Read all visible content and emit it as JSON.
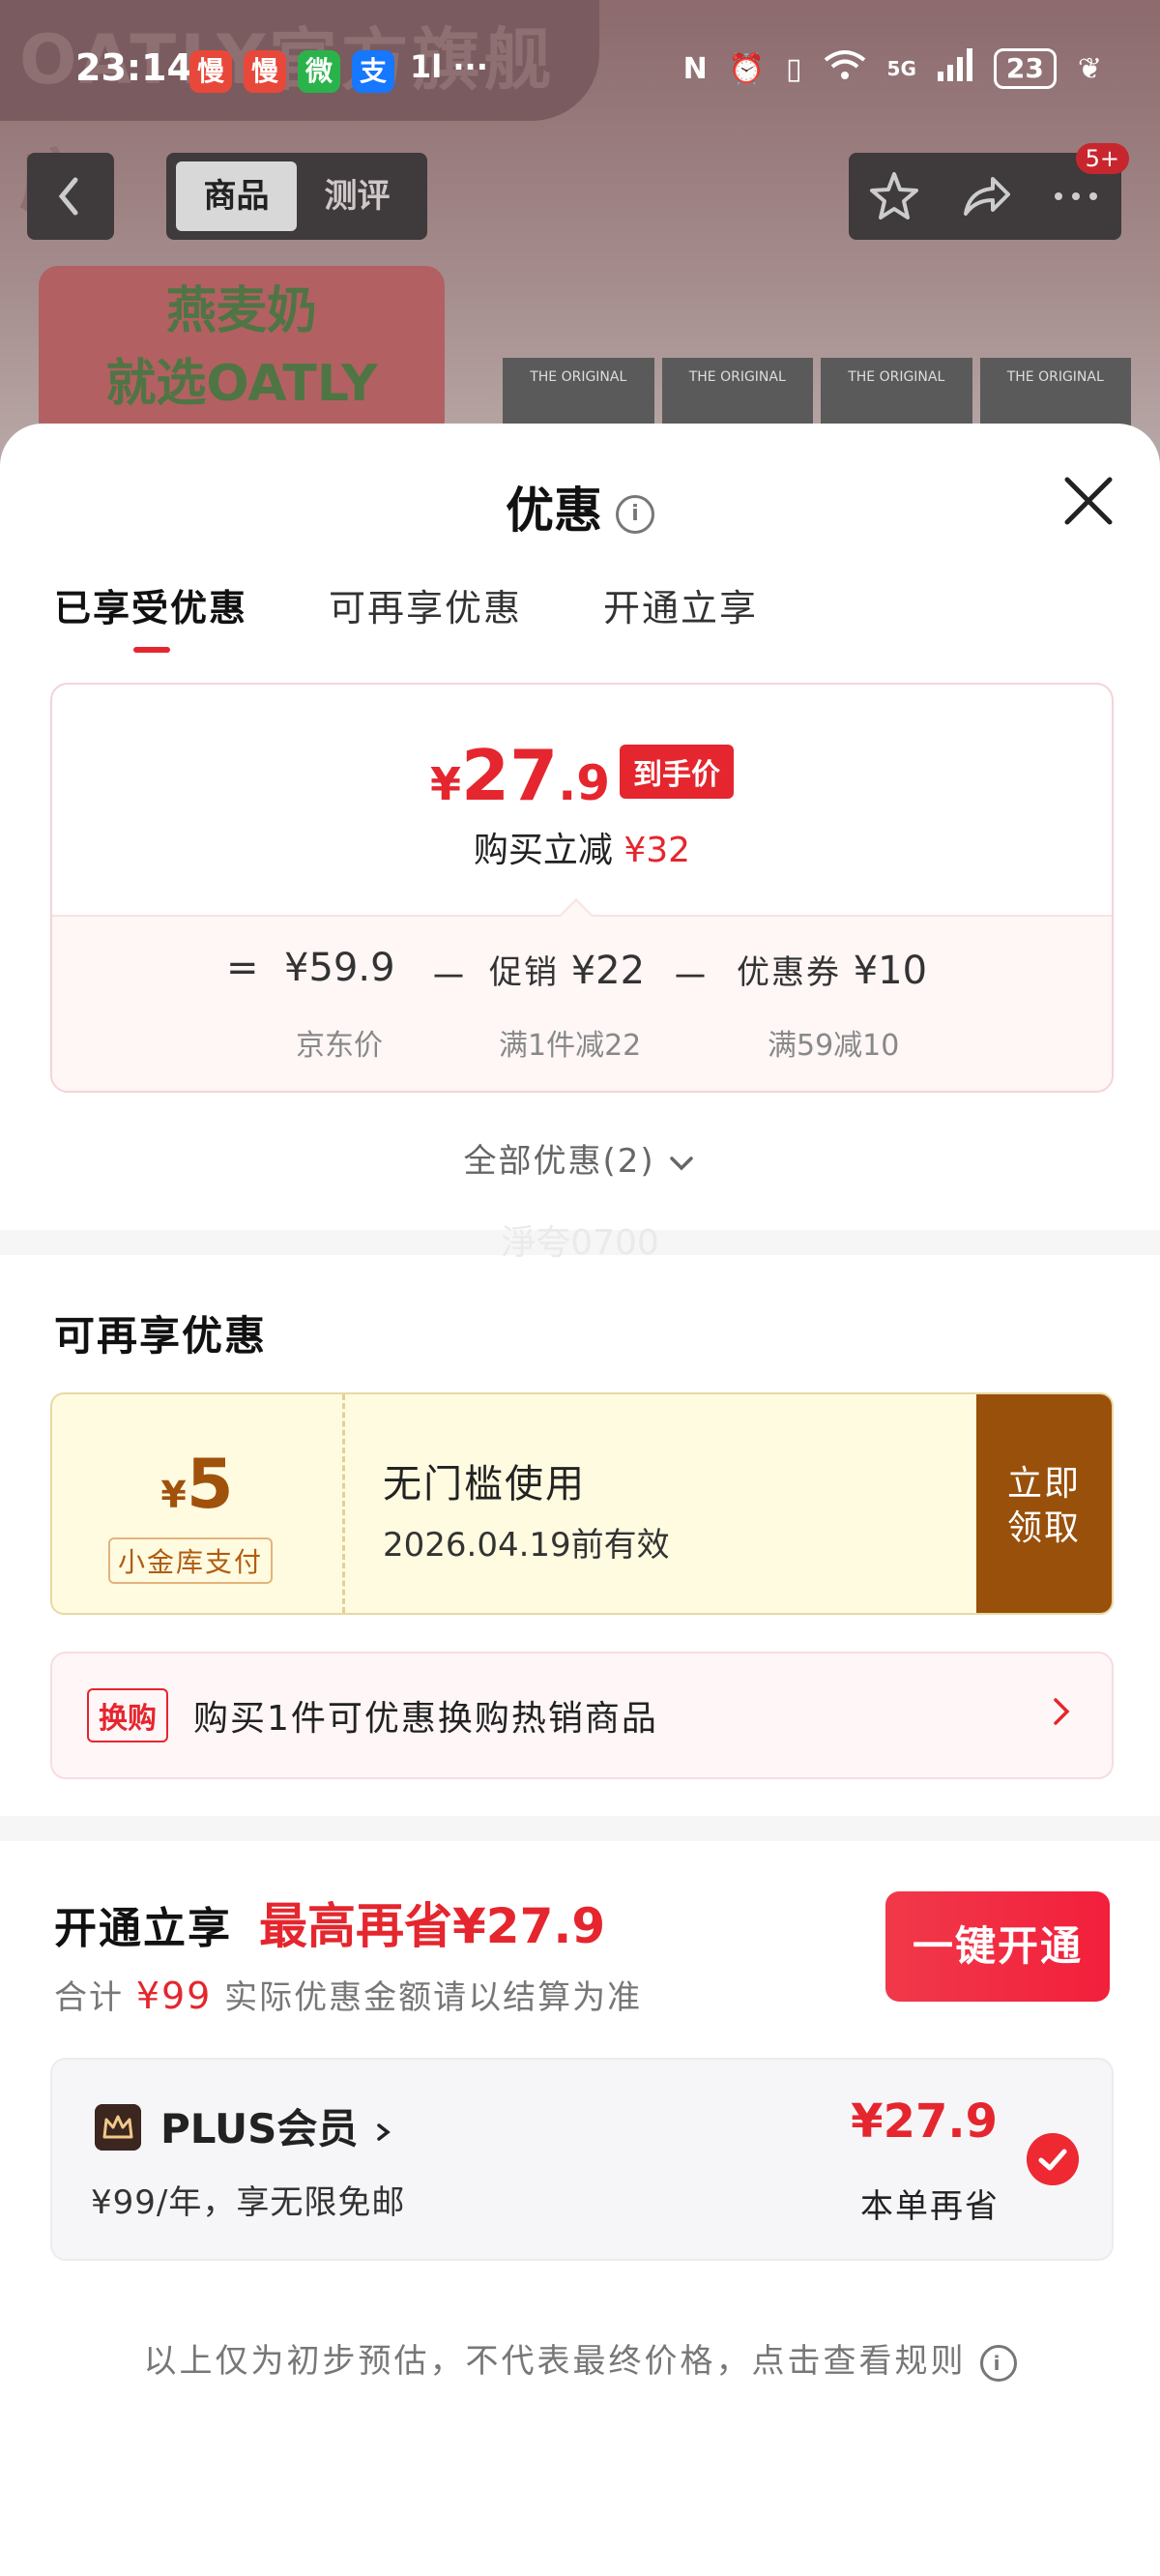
{
  "status_bar": {
    "time": "23:14",
    "app_icons": [
      {
        "label": "慢",
        "color": "#e8483a"
      },
      {
        "label": "慢",
        "color": "#e8483a"
      },
      {
        "label": "微",
        "color": "#2ab34a"
      },
      {
        "label": "支",
        "color": "#1677ff"
      }
    ],
    "indicators": "1l ···",
    "network": "5G",
    "battery": "23"
  },
  "background_page": {
    "store_name": "OATLY官方旗舰店",
    "tabs": [
      "商品",
      "测评"
    ],
    "active_tab": 0,
    "notification_badge": "5+",
    "banner_text": [
      "燕麦奶",
      "就选OATLY"
    ],
    "box_label": "THE ORIGINAL"
  },
  "sheet": {
    "title": "优惠",
    "tabs": [
      "已享受优惠",
      "可再享优惠",
      "开通立享"
    ],
    "active_tab": 0
  },
  "price_summary": {
    "final_price_yen": "¥",
    "final_price_int": "27",
    "final_price_dec": ".9",
    "final_tag": "到手价",
    "reduce_label": "购买立减",
    "reduce_amount": "¥32",
    "equals": "=",
    "minus": "－",
    "jd_price": "¥59.9",
    "jd_label": "京东价",
    "promo_label": "促销",
    "promo_amount": "¥22",
    "promo_desc": "满1件减22",
    "coupon_label": "优惠券",
    "coupon_amount": "¥10",
    "coupon_desc": "满59减10"
  },
  "all_offers": "全部优惠(2)",
  "watermark": "淨夸0700",
  "more_offers": {
    "title": "可再享优惠",
    "coupon": {
      "yen": "¥",
      "amount": "5",
      "tag": "小金库支付",
      "name": "无门槛使用",
      "validity": "2026.04.19前有效",
      "button": "立即领取"
    },
    "swap": {
      "tag": "换购",
      "text": "购买1件可优惠换购热销商品"
    }
  },
  "membership": {
    "title": "开通立享",
    "max_save": "最高再省¥27.9",
    "note_prefix": "合计",
    "note_amount": "¥99",
    "note_suffix": "实际优惠金额请以结算为准",
    "button": "一键开通",
    "plus": {
      "name": "PLUS会员",
      "desc": "¥99/年，享无限免邮",
      "save": "¥27.9",
      "save_label": "本单再省",
      "checked": true
    }
  },
  "disclaimer": "以上仅为初步预估，不代表最终价格，点击查看规则",
  "colors": {
    "accent_red": "#e5262e",
    "coupon_brown": "#98500b",
    "coupon_bg": "#fffbe1"
  }
}
